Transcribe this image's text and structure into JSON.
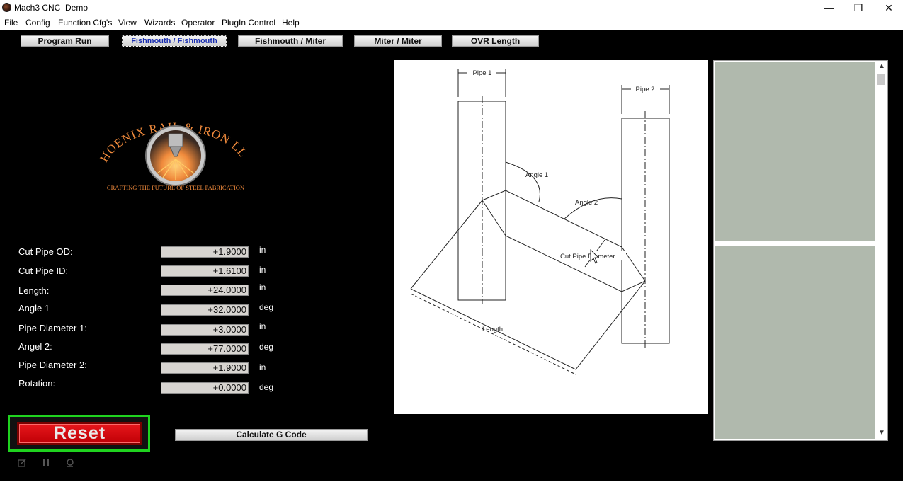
{
  "window": {
    "title": "Mach3 CNC  Demo",
    "minimize_glyph": "—",
    "restore_glyph": "❐",
    "close_glyph": "✕"
  },
  "menu": [
    "File",
    "Config",
    "Function Cfg's",
    "View",
    "Wizards",
    "Operator",
    "PlugIn Control",
    "Help"
  ],
  "tabs": [
    {
      "label": "Program Run",
      "active": false
    },
    {
      "label": "Fishmouth / Fishmouth",
      "active": true
    },
    {
      "label": "Fishmouth / Miter",
      "active": false
    },
    {
      "label": "Miter / Miter",
      "active": false
    },
    {
      "label": "OVR Length",
      "active": false
    }
  ],
  "logo": {
    "brand": "PHOENIX RAIL & IRON LLC.",
    "tagline": "CRAFTING THE FUTURE OF STEEL FABRICATION"
  },
  "fields": [
    {
      "label": "Cut Pipe OD:",
      "value": "+1.9000",
      "unit": "in"
    },
    {
      "label": "Cut Pipe ID:",
      "value": "+1.6100",
      "unit": "in"
    },
    {
      "label": "Length:",
      "value": "+24.0000",
      "unit": "in"
    },
    {
      "label": "Angle 1",
      "value": "+32.0000",
      "unit": "deg"
    },
    {
      "label": "Pipe Diameter 1:",
      "value": "+3.0000",
      "unit": "in"
    },
    {
      "label": "Angel 2:",
      "value": "+77.0000",
      "unit": "deg"
    },
    {
      "label": "Pipe Diameter 2:",
      "value": "+1.9000",
      "unit": "in"
    },
    {
      "label": "Rotation:",
      "value": "+0.0000",
      "unit": "deg"
    }
  ],
  "buttons": {
    "reset": "Reset",
    "calculate": "Calculate G Code"
  },
  "diagram_labels": {
    "pipe1": "Pipe 1",
    "pipe2": "Pipe 2",
    "angle1": "Angle 1",
    "angle2": "Angle 2",
    "cut_pipe_diameter": "Cut Pipe Diameter",
    "length": "Length"
  },
  "colors": {
    "background": "#000000",
    "reset_red": "#e7171c",
    "reset_border": "#1fd31f",
    "active_tab_text": "#1b2fb0",
    "preview_pane": "#b0b9ad",
    "logo_orange": "#f08a3c"
  },
  "icons": [
    "edit-icon",
    "pause-icon",
    "settings-icon"
  ]
}
